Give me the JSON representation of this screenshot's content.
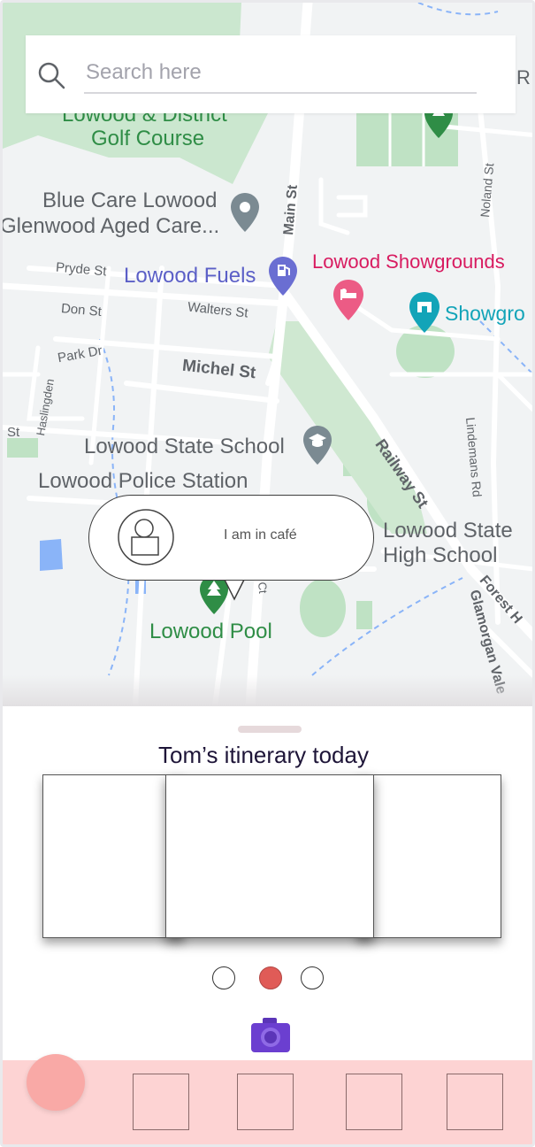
{
  "search": {
    "placeholder": "Search here",
    "icon": "search-icon"
  },
  "map": {
    "labels": {
      "golf_top": "Lowood & District",
      "golf_bottom": "Golf Course",
      "bluecare_1": "Blue Care Lowood",
      "bluecare_2": "Glenwood Aged Care...",
      "fuels": "Lowood Fuels",
      "showgrounds": "Lowood Showgrounds",
      "showgro": "Showgro",
      "state_school": "Lowood State School",
      "police": "Lowood Police Station",
      "high_school_1": "Lowood State",
      "high_school_2": "High School",
      "pool": "Lowood Pool",
      "main_st": "Main St",
      "pryde_st": "Pryde St",
      "don_st": "Don St",
      "walters_st": "Walters St",
      "park_dr": "Park Dr",
      "haslingden": "Haslingden",
      "michel_st": "Michel St",
      "railway_st": "Railway St",
      "noland_st": "Noland St",
      "lindemans_rd": "Lindemans Rd",
      "forest_h": "Forest H",
      "glamorgan": "Glamorgan Vale",
      "st_left": "St",
      "ct": "Ct",
      "r_edge": "R"
    },
    "colors": {
      "road": "#ffffff",
      "park": "#c8e6c9",
      "water": "#8ab4f8",
      "land": "#f1f3f4"
    }
  },
  "bubble": {
    "text": "I am in café"
  },
  "sheet": {
    "title": "Tom’s itinerary today",
    "active_page": 2,
    "page_count": 3
  },
  "navbar": {
    "accent": "#fdd3d3",
    "fab_color": "#f9a9a6"
  }
}
